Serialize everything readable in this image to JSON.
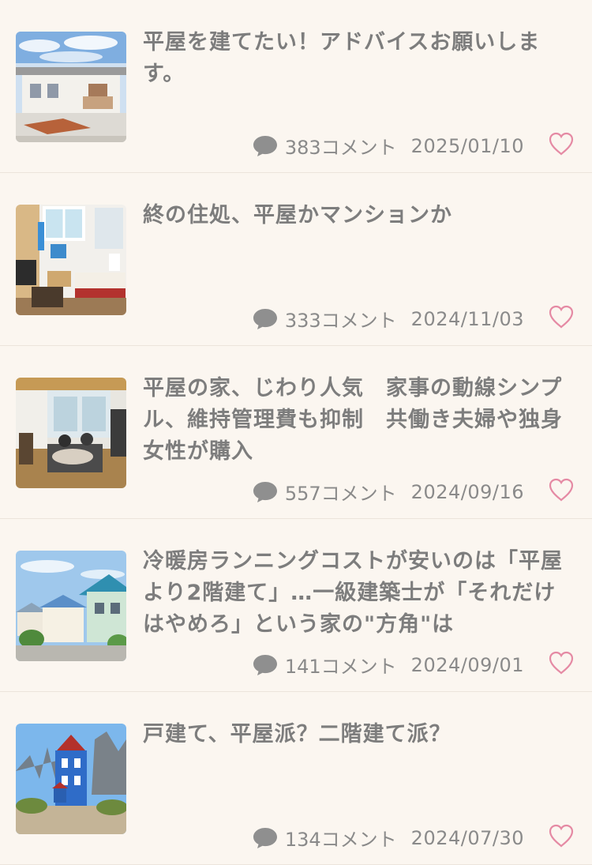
{
  "articles": [
    {
      "title": "平屋を建てたい！アドバイスお願いします。",
      "count": "383コメント",
      "date": "2025/01/10",
      "thumbnail": "single-story-house-photo"
    },
    {
      "title": "終の住処、平屋かマンションか",
      "count": "333コメント",
      "date": "2024/11/03",
      "thumbnail": "japanese-room-interior-photo"
    },
    {
      "title": "平屋の家、じわり人気　家事の動線シンプル、維持管理費も抑制　共働き夫婦や独身女性が購入",
      "count": "557コメント",
      "date": "2024/09/16",
      "thumbnail": "living-room-family-photo"
    },
    {
      "title": "冷暖房ランニングコストが安いのは「平屋より2階建て」…一級建築士が「それだけはやめろ」という家の\"方角\"は",
      "count": "141コメント",
      "date": "2024/09/01",
      "thumbnail": "two-story-houses-street-photo"
    },
    {
      "title": "戸建て、平屋派？二階建て派？",
      "count": "134コメント",
      "date": "2024/07/30",
      "thumbnail": "blue-tower-house-photo"
    }
  ],
  "colors": {
    "background": "#fbf6f0",
    "text": "#7d7d7d",
    "meta_text": "#8a8a8a",
    "comment_icon": "#8f8f8f",
    "heart": "#e58aa4",
    "divider": "#ece4dc"
  }
}
